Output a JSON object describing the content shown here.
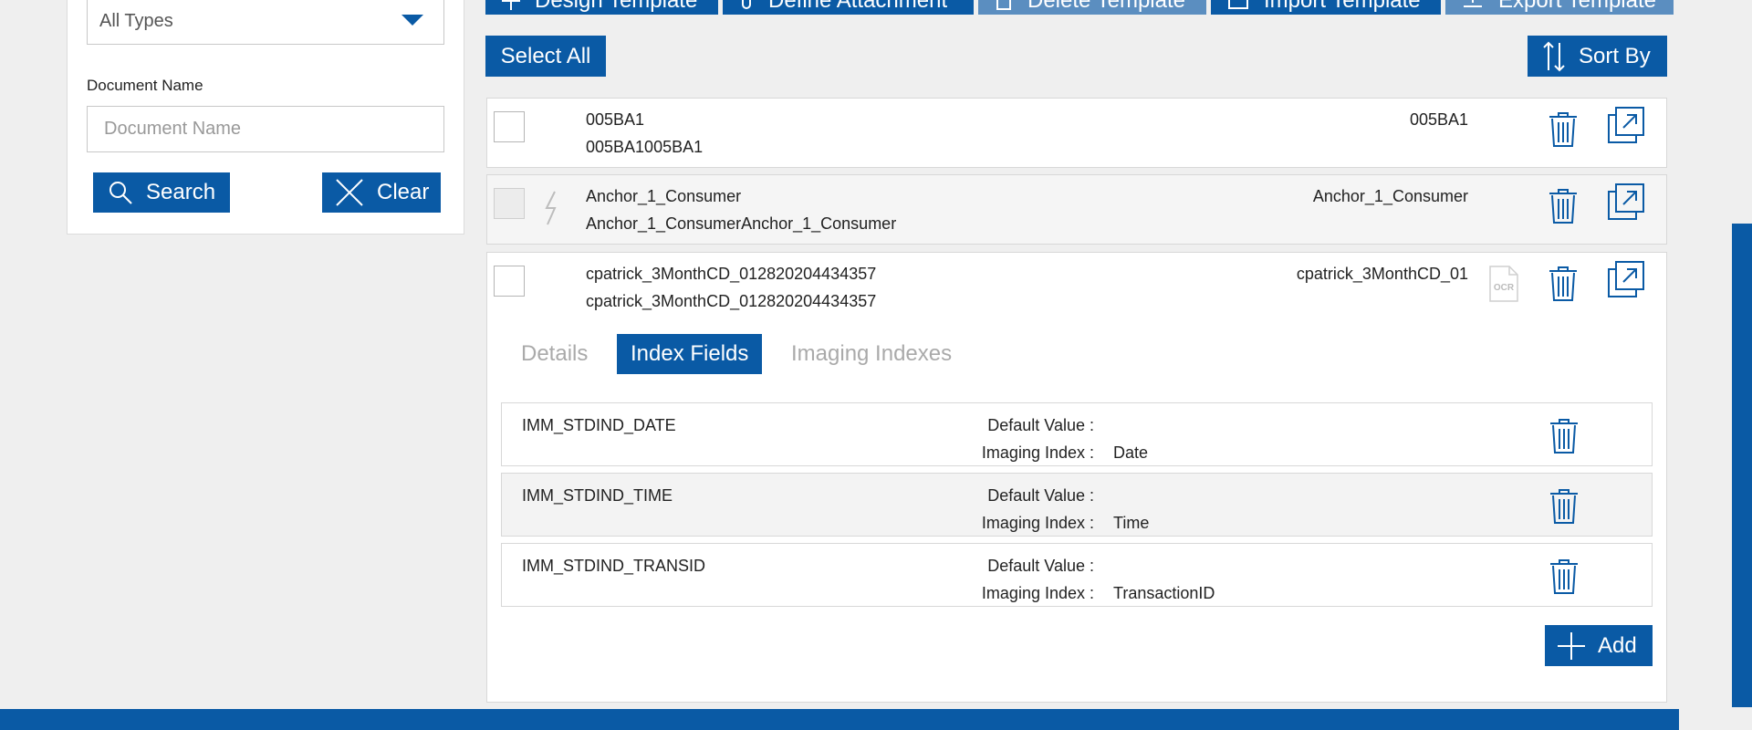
{
  "colors": {
    "accent": "#0a5aa5",
    "accent_dim": "#5b8ec0",
    "background": "#efefef"
  },
  "filter": {
    "type_select_value": "All Types",
    "docname_label": "Document Name",
    "docname_placeholder": "Document Name",
    "search_label": "Search",
    "clear_label": "Clear"
  },
  "toolbar": {
    "buttons": [
      {
        "label": "Design Template",
        "icon": "plus-icon",
        "dim": false
      },
      {
        "label": "Define Attachment",
        "icon": "paperclip-icon",
        "dim": false
      },
      {
        "label": "Delete Template",
        "icon": "trash-icon",
        "dim": true
      },
      {
        "label": "Import Template",
        "icon": "import-icon",
        "dim": false
      },
      {
        "label": "Export Template",
        "icon": "export-icon",
        "dim": true
      }
    ],
    "select_all_label": "Select All",
    "sort_by_label": "Sort By"
  },
  "templates": [
    {
      "name": "005BA1",
      "description": "005BA1005BA1",
      "right_label": "005BA1"
    },
    {
      "name": "Anchor_1_Consumer",
      "description": "Anchor_1_ConsumerAnchor_1_Consumer",
      "right_label": "Anchor_1_Consumer"
    },
    {
      "name": "cpatrick_3MonthCD_012820204434357",
      "description": "cpatrick_3MonthCD_012820204434357",
      "right_label": "cpatrick_3MonthCD_01"
    }
  ],
  "detail": {
    "tabs": [
      "Details",
      "Index Fields",
      "Imaging Indexes"
    ],
    "active_tab": "Index Fields",
    "default_value_label": "Default Value :",
    "imaging_index_label": "Imaging Index :",
    "fields": [
      {
        "name": "IMM_STDIND_DATE",
        "default_value": "",
        "imaging_index": "Date"
      },
      {
        "name": "IMM_STDIND_TIME",
        "default_value": "",
        "imaging_index": "Time"
      },
      {
        "name": "IMM_STDIND_TRANSID",
        "default_value": "",
        "imaging_index": "TransactionID"
      }
    ],
    "add_label": "Add"
  }
}
